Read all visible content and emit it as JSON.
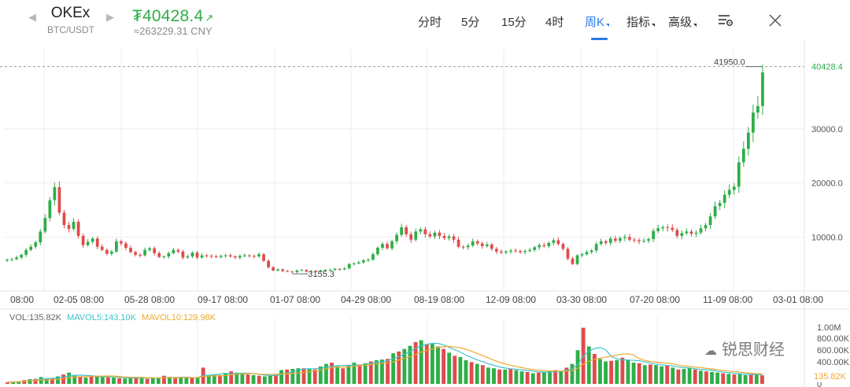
{
  "header": {
    "exchange": "OKEx",
    "pair": "BTC/USDT",
    "price": "₮40428.4",
    "price_arrow": "↗",
    "price_cny": "≈263229.31 CNY",
    "tabs": [
      {
        "label": "分时",
        "active": false
      },
      {
        "label": "5分",
        "active": false
      },
      {
        "label": "15分",
        "active": false
      },
      {
        "label": "4时",
        "active": false
      },
      {
        "label": "周K",
        "active": true,
        "dropdown": true
      },
      {
        "label": "指标",
        "active": false,
        "dropdown": true
      },
      {
        "label": "高级",
        "active": false,
        "dropdown": true
      }
    ],
    "icons": [
      "prev-arrow-icon",
      "next-arrow-icon",
      "chart-settings-icon",
      "close-icon"
    ]
  },
  "colors": {
    "up": "#2eae48",
    "down": "#e04b4b",
    "accent": "#2c7be5",
    "ma5": "#3cc3c8",
    "ma10": "#f0a830",
    "grid": "#eeeeee",
    "text_muted": "#8a8a8a"
  },
  "chart_data": {
    "type": "candlestick",
    "timeframe": "weekly",
    "price_axis": {
      "ticks": [
        "10000.0",
        "20000.0",
        "30000.0"
      ],
      "tick_values": [
        10000,
        20000,
        30000
      ],
      "ylim": [
        0,
        44800
      ],
      "current_price_label": "40428.4",
      "current_price": 40428.4
    },
    "annotations": {
      "high_label": "41950.0",
      "high": 41950,
      "low_label": "3155.3",
      "low": 3155.3
    },
    "x_labels": [
      "08:00",
      "02-05 08:00",
      "05-28 08:00",
      "09-17 08:00",
      "01-07 08:00",
      "04-29 08:00",
      "08-19 08:00",
      "12-09 08:00",
      "03-30 08:00",
      "07-20 08:00",
      "11-09 08:00",
      "03-01 08:00"
    ],
    "close_series": [
      5800,
      5900,
      6200,
      6700,
      7600,
      8200,
      9000,
      11000,
      13500,
      16800,
      19200,
      14500,
      12200,
      11500,
      12800,
      10200,
      8500,
      9100,
      9700,
      8200,
      7600,
      6900,
      7300,
      9200,
      8800,
      8000,
      7200,
      6700,
      6600,
      7600,
      7900,
      7000,
      6300,
      6400,
      7000,
      7600,
      7300,
      6200,
      6400,
      7100,
      6200,
      6600,
      6500,
      6400,
      6300,
      6500,
      6600,
      6400,
      6200,
      6500,
      6600,
      6500,
      6400,
      6800,
      5600,
      4400,
      3800,
      4000,
      3700,
      3600,
      3500,
      3800,
      3900,
      3600,
      3700,
      3600,
      3800,
      3900,
      3900,
      4100,
      4000,
      4200,
      5000,
      5100,
      5300,
      5700,
      5800,
      6800,
      8000,
      8700,
      7900,
      9200,
      10400,
      11800,
      10500,
      9500,
      11000,
      11400,
      10500,
      10100,
      10800,
      10200,
      9800,
      10100,
      9500,
      8200,
      8100,
      8400,
      9200,
      8800,
      8300,
      8600,
      7800,
      7300,
      7100,
      7300,
      7500,
      7400,
      7200,
      7400,
      7600,
      8100,
      8500,
      8300,
      8900,
      9400,
      8700,
      7800,
      6000,
      5000,
      6600,
      6800,
      7200,
      7500,
      8700,
      9200,
      8900,
      9700,
      9300,
      9800,
      10000,
      9500,
      9400,
      9200,
      9300,
      9600,
      11100,
      11600,
      11800,
      11700,
      11300,
      10200,
      10700,
      11000,
      10600,
      10800,
      11600,
      12200,
      13800,
      15700,
      16300,
      17800,
      18700,
      19300,
      23800,
      26300,
      29300,
      33000,
      34200,
      40428.4
    ],
    "volume_series": [
      25,
      35,
      40,
      60,
      75,
      80,
      110,
      85,
      90,
      120,
      150,
      180,
      140,
      110,
      100,
      130,
      120,
      110,
      105,
      100,
      90,
      85,
      100,
      110,
      90,
      80,
      95,
      100,
      130,
      110,
      90,
      100,
      110,
      95,
      100,
      260,
      130,
      150,
      140,
      170,
      200,
      180,
      160,
      150,
      140,
      130,
      120,
      130,
      150,
      220,
      230,
      240,
      250,
      250,
      240,
      230,
      280,
      320,
      340,
      280,
      250,
      300,
      340,
      310,
      330,
      360,
      380,
      390,
      400,
      490,
      520,
      560,
      610,
      670,
      700,
      630,
      640,
      600,
      560,
      500,
      450,
      430,
      380,
      350,
      320,
      300,
      260,
      250,
      230,
      230,
      240,
      220,
      200,
      190,
      170,
      180,
      190,
      210,
      220,
      200,
      260,
      320,
      540,
      900,
      600,
      480,
      400,
      360,
      370,
      380,
      420,
      380,
      340,
      330,
      300,
      310,
      300,
      280,
      290,
      260,
      230,
      240,
      250,
      230,
      210,
      200,
      190,
      180,
      170,
      160,
      150,
      155,
      140,
      150,
      145,
      135.82
    ],
    "volume_axis": {
      "ticks": [
        "1.00M",
        "800.00K",
        "600.00K",
        "400.00K",
        "0"
      ],
      "tick_values": [
        1000000,
        800000,
        600000,
        400000,
        0
      ],
      "current_label": "135.82K"
    },
    "volume_legend": {
      "vol": "VOL:135.82K",
      "mavol5": "MAVOL5:143.10K",
      "mavol10": "MAVOL10:129.98K"
    }
  },
  "watermark": "锐思财经"
}
